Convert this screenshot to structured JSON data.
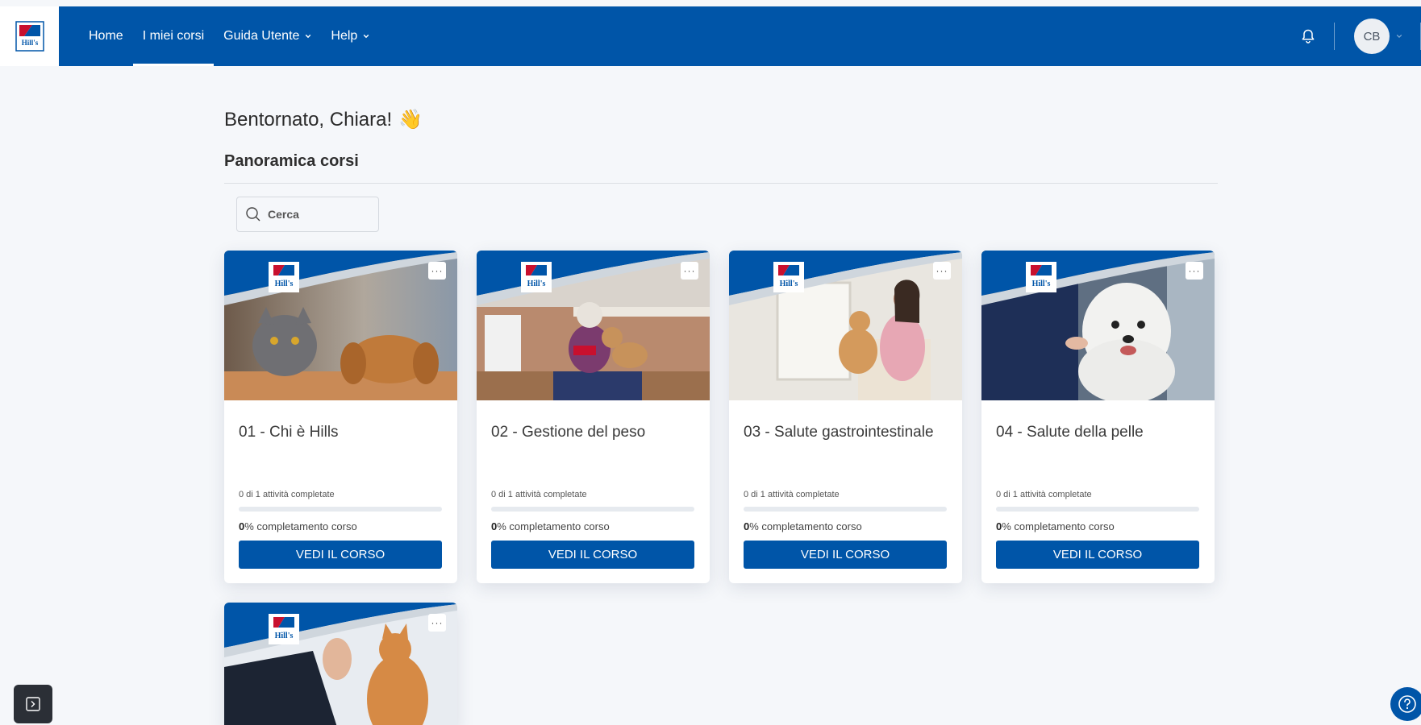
{
  "nav": {
    "logo_text": "Hill's",
    "items": [
      {
        "label": "Home",
        "active": false,
        "dropdown": false
      },
      {
        "label": "I miei corsi",
        "active": true,
        "dropdown": false
      },
      {
        "label": "Guida Utente",
        "active": false,
        "dropdown": true
      },
      {
        "label": "Help",
        "active": false,
        "dropdown": true
      }
    ],
    "bell_icon": "bell-icon",
    "avatar_initials": "CB"
  },
  "main": {
    "greeting": "Bentornato, Chiara!",
    "greeting_emoji": "👋",
    "section_title": "Panoramica corsi",
    "search": {
      "placeholder": "Cerca",
      "value": ""
    }
  },
  "cards": [
    {
      "title": "01 - Chi è Hills",
      "activities": "0 di 1 attività completate",
      "progress": 0,
      "percent": "0",
      "completion_suffix": "% completamento corso",
      "button": "VEDI IL CORSO"
    },
    {
      "title": "02 - Gestione del peso",
      "activities": "0 di 1 attività completate",
      "progress": 0,
      "percent": "0",
      "completion_suffix": "% completamento corso",
      "button": "VEDI IL CORSO"
    },
    {
      "title": "03 - Salute gastrointestinale",
      "activities": "0 di 1 attività completate",
      "progress": 0,
      "percent": "0",
      "completion_suffix": "% completamento corso",
      "button": "VEDI IL CORSO"
    },
    {
      "title": "04 - Salute della pelle",
      "activities": "0 di 1 attività completate",
      "progress": 0,
      "percent": "0",
      "completion_suffix": "% completamento corso",
      "button": "VEDI IL CORSO"
    },
    {
      "title": "",
      "activities": "",
      "progress": 0,
      "percent": "",
      "completion_suffix": "",
      "button": ""
    }
  ],
  "colors": {
    "brand_blue": "#0055a8",
    "page_bg": "#f5f7fa"
  },
  "menu_glyph": "···",
  "hills_badge_text": "Hill's"
}
